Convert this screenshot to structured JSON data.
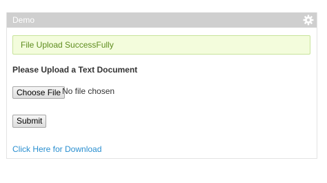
{
  "panel": {
    "title": "Demo",
    "settings_icon": "gear-icon",
    "header_color": "#cfcfcf"
  },
  "alert": {
    "message": "File Upload SuccessFully",
    "text_color": "#5d8c1d",
    "background": "#f3fcdc"
  },
  "form": {
    "upload_label": "Please Upload a Text Document",
    "file_button_label": "Choose File",
    "file_status": "No file chosen",
    "submit_label": "Submit"
  },
  "download": {
    "link_text": "Click Here for Download",
    "link_color": "#2a8fd0"
  }
}
